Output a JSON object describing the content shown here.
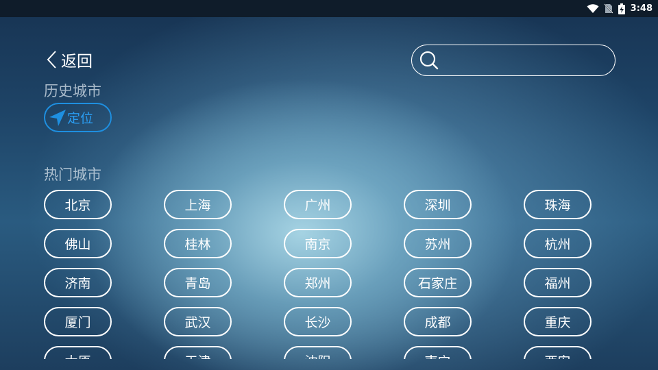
{
  "status_bar": {
    "time": "3:48",
    "icons": [
      "wifi-icon",
      "no-sim-icon",
      "battery-charging-icon"
    ]
  },
  "header": {
    "back_label": "返回",
    "back_icon": "chevron-left-icon",
    "search": {
      "icon": "search-icon",
      "value": "",
      "placeholder": ""
    }
  },
  "history": {
    "title": "历史城市",
    "locate_label": "定位",
    "locate_icon": "location-arrow-icon",
    "locate_color": "#1e8fe0"
  },
  "hot": {
    "title": "热门城市",
    "rows": [
      [
        "北京",
        "上海",
        "广州",
        "深圳",
        "珠海"
      ],
      [
        "佛山",
        "桂林",
        "南京",
        "苏州",
        "杭州"
      ],
      [
        "济南",
        "青岛",
        "郑州",
        "石家庄",
        "福州"
      ],
      [
        "厦门",
        "武汉",
        "长沙",
        "成都",
        "重庆"
      ],
      [
        "太原",
        "天津",
        "沈阳",
        "南宁",
        "西安"
      ]
    ]
  }
}
